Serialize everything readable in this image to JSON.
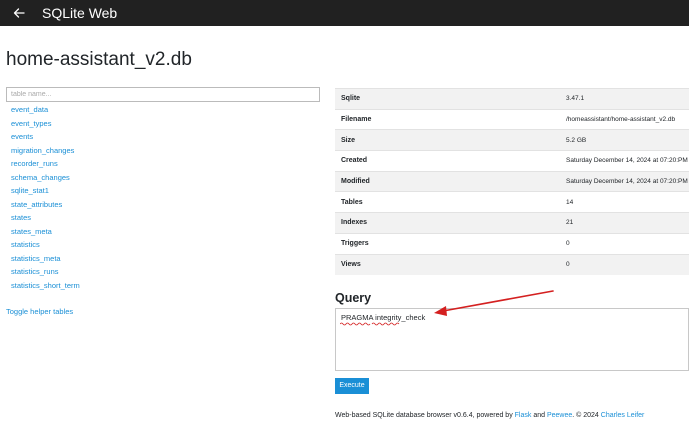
{
  "header": {
    "app_title": "SQLite Web",
    "back_icon": "arrow-left-icon"
  },
  "database": {
    "name": "home-assistant_v2.db"
  },
  "search": {
    "placeholder": "table name..."
  },
  "tables": [
    "event_data",
    "event_types",
    "events",
    "migration_changes",
    "recorder_runs",
    "schema_changes",
    "sqlite_stat1",
    "state_attributes",
    "states",
    "states_meta",
    "statistics",
    "statistics_meta",
    "statistics_runs",
    "statistics_short_term"
  ],
  "toggle_helper_label": "Toggle helper tables",
  "info": [
    {
      "key": "Sqlite",
      "value": "3.47.1"
    },
    {
      "key": "Filename",
      "value": "/homeassistant/home-assistant_v2.db"
    },
    {
      "key": "Size",
      "value": "5.2 GB"
    },
    {
      "key": "Created",
      "value": "Saturday December 14, 2024 at 07:20:PM"
    },
    {
      "key": "Modified",
      "value": "Saturday December 14, 2024 at 07:20:PM"
    },
    {
      "key": "Tables",
      "value": "14"
    },
    {
      "key": "Indexes",
      "value": "21"
    },
    {
      "key": "Triggers",
      "value": "0"
    },
    {
      "key": "Views",
      "value": "0"
    }
  ],
  "query": {
    "heading": "Query",
    "text": "PRAGMA integrity_check",
    "execute_label": "Execute"
  },
  "footer": {
    "prefix": "Web-based SQLite database browser v0.6.4, powered by ",
    "flask": "Flask",
    "and": " and ",
    "peewee": "Peewee",
    "copyright": ". © 2024 ",
    "author": "Charles Leifer"
  },
  "colors": {
    "topbar": "#212121",
    "link": "#1a8fd6",
    "button": "#1a8fd6",
    "annotation": "#d42020"
  }
}
